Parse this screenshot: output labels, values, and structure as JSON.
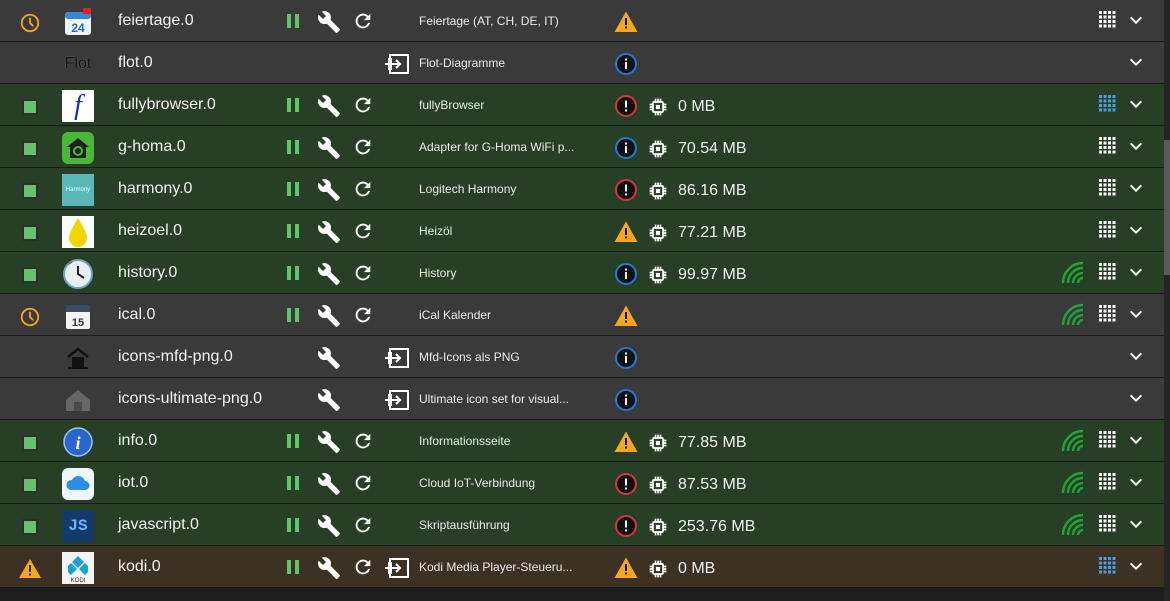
{
  "colors": {
    "row_running": "#263f25",
    "row_stopped": "#3a3a3a",
    "row_warning": "#3d3123",
    "status_green": "#66c26f",
    "info_blue": "#1f7ad1",
    "error_red": "#d2373a",
    "warning_orange": "#f6a623"
  },
  "adapters": [
    {
      "name": "feiertage.0",
      "description": "Feiertage (AT, CH, DE, IT)",
      "status": "clock",
      "row": "gray",
      "logo": "calendar-24-icon",
      "logo_text": "24",
      "controls": [
        "pause",
        "wrench",
        "reload"
      ],
      "info": "warning",
      "memory": "",
      "wifi": false,
      "grid": "white"
    },
    {
      "name": "flot.0",
      "description": "Flot-Diagramme",
      "status": "none",
      "row": "gray",
      "logo": "flot-logo",
      "logo_text": "Flot",
      "controls": [
        "link"
      ],
      "info": "info",
      "memory": "",
      "wifi": false,
      "grid": "none"
    },
    {
      "name": "fullybrowser.0",
      "description": "fullyBrowser",
      "status": "on",
      "row": "green",
      "logo": "fully-browser-icon",
      "logo_text": "f",
      "controls": [
        "pause",
        "wrench",
        "reload"
      ],
      "info": "error",
      "memory": "0 MB",
      "wifi": false,
      "grid": "blue"
    },
    {
      "name": "g-homa.0",
      "description": "Adapter for G-Homa WiFi p...",
      "status": "on",
      "row": "green",
      "logo": "g-homa-icon",
      "logo_text": "",
      "controls": [
        "pause",
        "wrench",
        "reload"
      ],
      "info": "info",
      "memory": "70.54 MB",
      "wifi": false,
      "grid": "white"
    },
    {
      "name": "harmony.0",
      "description": "Logitech Harmony",
      "status": "on",
      "row": "green",
      "logo": "harmony-icon",
      "logo_text": "Harmony",
      "controls": [
        "pause",
        "wrench",
        "reload"
      ],
      "info": "error",
      "memory": "86.16 MB",
      "wifi": false,
      "grid": "white"
    },
    {
      "name": "heizoel.0",
      "description": "Heizöl",
      "status": "on",
      "row": "green",
      "logo": "oil-drop-icon",
      "logo_text": "",
      "controls": [
        "pause",
        "wrench",
        "reload"
      ],
      "info": "warning",
      "memory": "77.21 MB",
      "wifi": false,
      "grid": "white"
    },
    {
      "name": "history.0",
      "description": "History",
      "status": "on",
      "row": "green",
      "logo": "clock-history-icon",
      "logo_text": "",
      "controls": [
        "pause",
        "wrench",
        "reload"
      ],
      "info": "info",
      "memory": "99.97 MB",
      "wifi": true,
      "grid": "white"
    },
    {
      "name": "ical.0",
      "description": "iCal Kalender",
      "status": "clock",
      "row": "gray",
      "logo": "ical-calendar-icon",
      "logo_text": "15",
      "controls": [
        "pause",
        "wrench",
        "reload"
      ],
      "info": "warning",
      "memory": "",
      "wifi": true,
      "grid": "white"
    },
    {
      "name": "icons-mfd-png.0",
      "description": "Mfd-Icons als PNG",
      "status": "none",
      "row": "gray",
      "logo": "mfd-house-icon",
      "logo_text": "",
      "controls": [
        "wrench",
        "link"
      ],
      "info": "info",
      "memory": "",
      "wifi": false,
      "grid": "none"
    },
    {
      "name": "icons-ultimate-png.0",
      "description": "Ultimate icon set for visual...",
      "status": "none",
      "row": "gray",
      "logo": "ultimate-house-icon",
      "logo_text": "",
      "controls": [
        "wrench",
        "link"
      ],
      "info": "info",
      "memory": "",
      "wifi": false,
      "grid": "none"
    },
    {
      "name": "info.0",
      "description": "Informationsseite",
      "status": "on",
      "row": "green",
      "logo": "info-globe-icon",
      "logo_text": "i",
      "controls": [
        "pause",
        "wrench",
        "reload"
      ],
      "info": "warning",
      "memory": "77.85 MB",
      "wifi": true,
      "grid": "white"
    },
    {
      "name": "iot.0",
      "description": "Cloud IoT-Verbindung",
      "status": "on",
      "row": "green",
      "logo": "cloud-icon",
      "logo_text": "",
      "controls": [
        "pause",
        "wrench",
        "reload"
      ],
      "info": "error",
      "memory": "87.53 MB",
      "wifi": true,
      "grid": "white"
    },
    {
      "name": "javascript.0",
      "description": "Skriptausführung",
      "status": "on",
      "row": "green",
      "logo": "javascript-icon",
      "logo_text": "JS",
      "controls": [
        "pause",
        "wrench",
        "reload"
      ],
      "info": "error",
      "memory": "253.76 MB",
      "wifi": true,
      "grid": "white"
    },
    {
      "name": "kodi.0",
      "description": "Kodi Media Player-Steueru...",
      "status": "warning",
      "row": "orange",
      "logo": "kodi-icon",
      "logo_text": "KODI",
      "controls": [
        "pause",
        "wrench",
        "reload",
        "link"
      ],
      "info": "warning",
      "memory": "0 MB",
      "wifi": false,
      "grid": "blue"
    }
  ]
}
